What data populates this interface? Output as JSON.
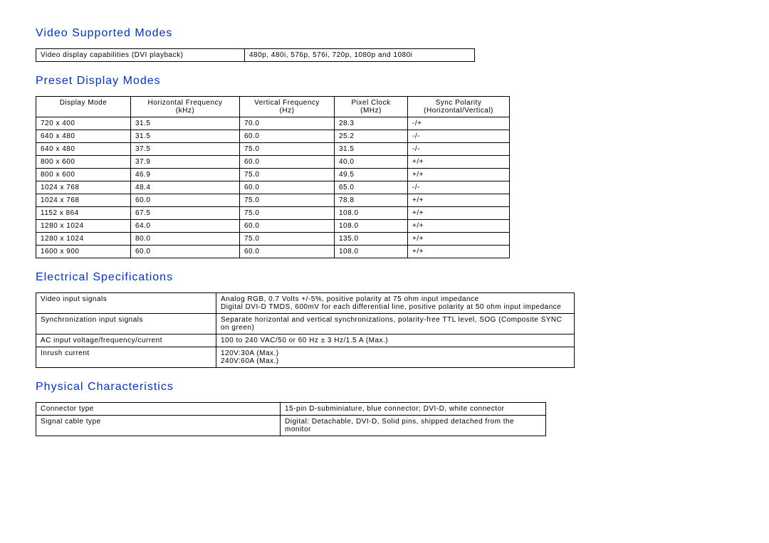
{
  "sections": {
    "video_supported": {
      "title": "Video Supported Modes",
      "row": {
        "label": "Video display capabilities (DVI playback)",
        "value": "480p, 480i, 576p, 576i, 720p, 1080p and 1080i"
      }
    },
    "preset": {
      "title": "Preset Display Modes",
      "headers": {
        "c0": "Display Mode",
        "c1a": "Horizontal Frequency",
        "c1b": "(kHz)",
        "c2a": "Vertical Frequency",
        "c2b": "(Hz)",
        "c3a": "Pixel Clock",
        "c3b": "(MHz)",
        "c4a": "Sync Polarity",
        "c4b": "(Horizontal/Vertical)"
      },
      "rows": [
        {
          "mode": "720 x 400",
          "hf": "31.5",
          "vf": "70.0",
          "pc": "28.3",
          "sp": "-/+"
        },
        {
          "mode": "640 x 480",
          "hf": "31.5",
          "vf": "60.0",
          "pc": "25.2",
          "sp": "-/-"
        },
        {
          "mode": "640 x 480",
          "hf": "37.5",
          "vf": "75.0",
          "pc": "31.5",
          "sp": "-/-"
        },
        {
          "mode": "800 x 600",
          "hf": "37.9",
          "vf": "60.0",
          "pc": "40.0",
          "sp": "+/+"
        },
        {
          "mode": "800 x 600",
          "hf": "46.9",
          "vf": "75.0",
          "pc": "49.5",
          "sp": "+/+"
        },
        {
          "mode": "1024 x 768",
          "hf": "48.4",
          "vf": "60.0",
          "pc": "65.0",
          "sp": "-/-"
        },
        {
          "mode": "1024 x 768",
          "hf": "60.0",
          "vf": "75.0",
          "pc": "78.8",
          "sp": "+/+"
        },
        {
          "mode": "1152 x 864",
          "hf": "67.5",
          "vf": "75.0",
          "pc": "108.0",
          "sp": "+/+"
        },
        {
          "mode": "1280 x 1024",
          "hf": "64.0",
          "vf": "60.0",
          "pc": "108.0",
          "sp": "+/+"
        },
        {
          "mode": "1280 x 1024",
          "hf": "80.0",
          "vf": "75.0",
          "pc": "135.0",
          "sp": "+/+"
        },
        {
          "mode": "1600 x 900",
          "hf": "60.0",
          "vf": "60.0",
          "pc": "108.0",
          "sp": "+/+"
        }
      ]
    },
    "electrical": {
      "title": "Electrical Specifications",
      "rows": [
        {
          "label": "Video input signals",
          "value": "Analog RGB, 0.7 Volts +/-5%, positive polarity at 75 ohm input impedance\nDigital DVI-D TMDS, 600mV for each differential line, positive polarity at 50 ohm input impedance"
        },
        {
          "label": "Synchronization input signals",
          "value": "Separate horizontal and vertical synchronizations, polarity-free TTL level, SOG (Composite SYNC on green)"
        },
        {
          "label": "AC input voltage/frequency/current",
          "value": "100 to 240 VAC/50 or 60 Hz ± 3 Hz/1.5 A (Max.)"
        },
        {
          "label": "Inrush current",
          "value": "120V:30A (Max.)\n240V:60A (Max.)"
        }
      ]
    },
    "physical": {
      "title": "Physical Characteristics",
      "rows": [
        {
          "label": "Connector type",
          "value": "15-pin D-subminiature, blue connector; DVI-D, white connector"
        },
        {
          "label": "Signal cable type",
          "value": "Digital: Detachable, DVI-D, Solid pins, shipped detached from the monitor"
        }
      ]
    }
  }
}
